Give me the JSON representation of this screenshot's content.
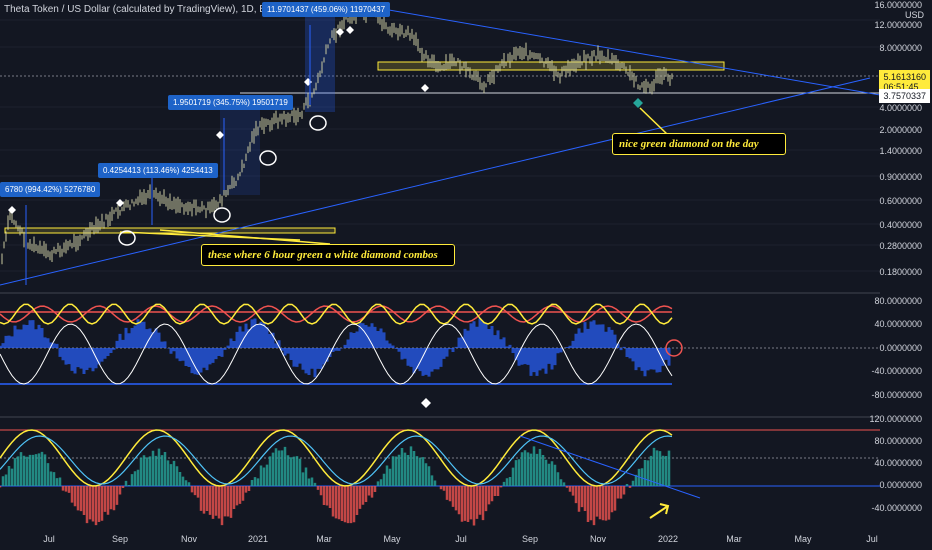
{
  "chart": {
    "symbol": "Theta Token / US Dollar (calculated by TradingView), 1D, BINANCE",
    "currency": "USD",
    "current_price": "5.1613160",
    "countdown": "06:51:45",
    "support_price": "3.7570337"
  },
  "price_axis": [
    "16.0000000",
    "12.0000000",
    "8.0000000",
    "4.0000000",
    "2.0000000",
    "1.4000000",
    "0.9000000",
    "0.6000000",
    "0.4000000",
    "0.2800000",
    "0.1800000"
  ],
  "osc1_axis": [
    "80.0000000",
    "40.0000000",
    "0.0000000",
    "-40.0000000",
    "-80.0000000"
  ],
  "osc2_axis": [
    "120.0000000",
    "80.0000000",
    "40.0000000",
    "0.0000000",
    "-40.0000000"
  ],
  "time_axis": [
    "Jul",
    "Sep",
    "Nov",
    "2021",
    "Mar",
    "May",
    "Jul",
    "Sep",
    "Nov",
    "2022",
    "Mar",
    "May",
    "Jul"
  ],
  "bubbles": [
    "11.9701437 (459.06%) 11970437",
    "1.9501719 (345.75%) 19501719",
    "0.4254413 (113.46%) 4254413",
    "6780 (994.42%) 5276780"
  ],
  "notes": {
    "green_diamond": "nice green diamond on the day",
    "combos": "these where 6 hour green a white diamond combos"
  },
  "colors": {
    "background": "#131722",
    "candle": "#c8c8a0",
    "trendline": "#2962ff",
    "highlight": "#ffeb3b",
    "osc_red": "#ef5350",
    "osc_blue": "#2962ff",
    "hist_green": "#26a69a"
  },
  "chart_data": {
    "type": "line",
    "x_range": [
      "2020-06",
      "2022-07"
    ],
    "price_scale": "log",
    "y_range": [
      0.14,
      16
    ]
  }
}
